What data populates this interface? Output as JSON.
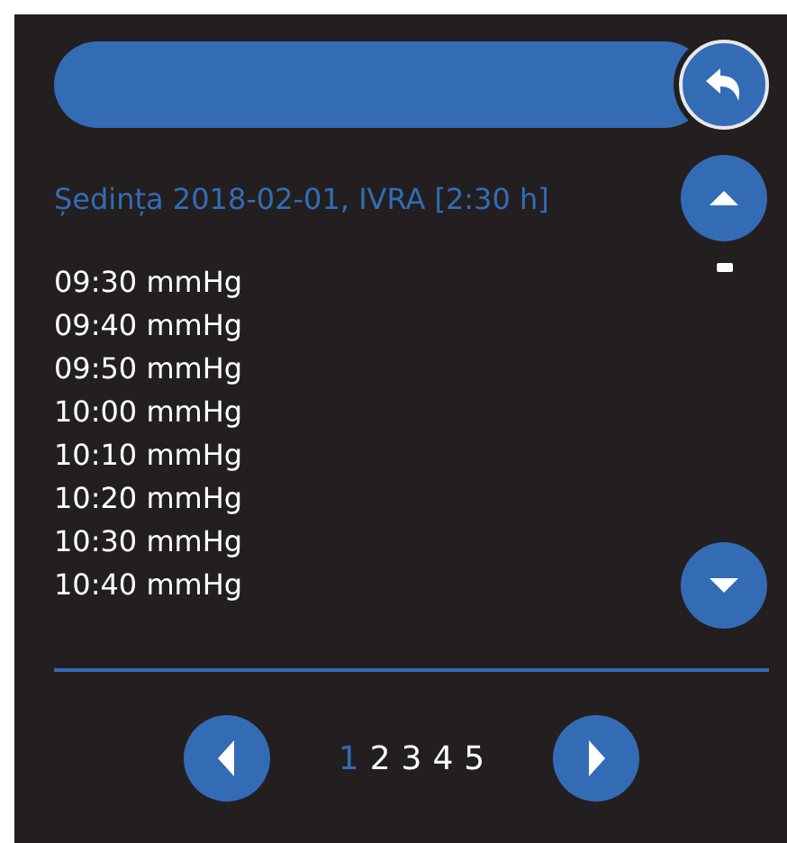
{
  "session_title": "Ședința 2018-02-01, IVRA [2:30 h]",
  "readings": [
    "09:30 mmHg",
    "09:40 mmHg",
    "09:50 mmHg",
    "10:00 mmHg",
    "10:10 mmHg",
    "10:20 mmHg",
    "10:30 mmHg",
    "10:40 mmHg"
  ],
  "pages": [
    {
      "label": "1",
      "selected": true
    },
    {
      "label": "2",
      "selected": false
    },
    {
      "label": "3",
      "selected": false
    },
    {
      "label": "4",
      "selected": false
    },
    {
      "label": "5",
      "selected": false
    }
  ]
}
